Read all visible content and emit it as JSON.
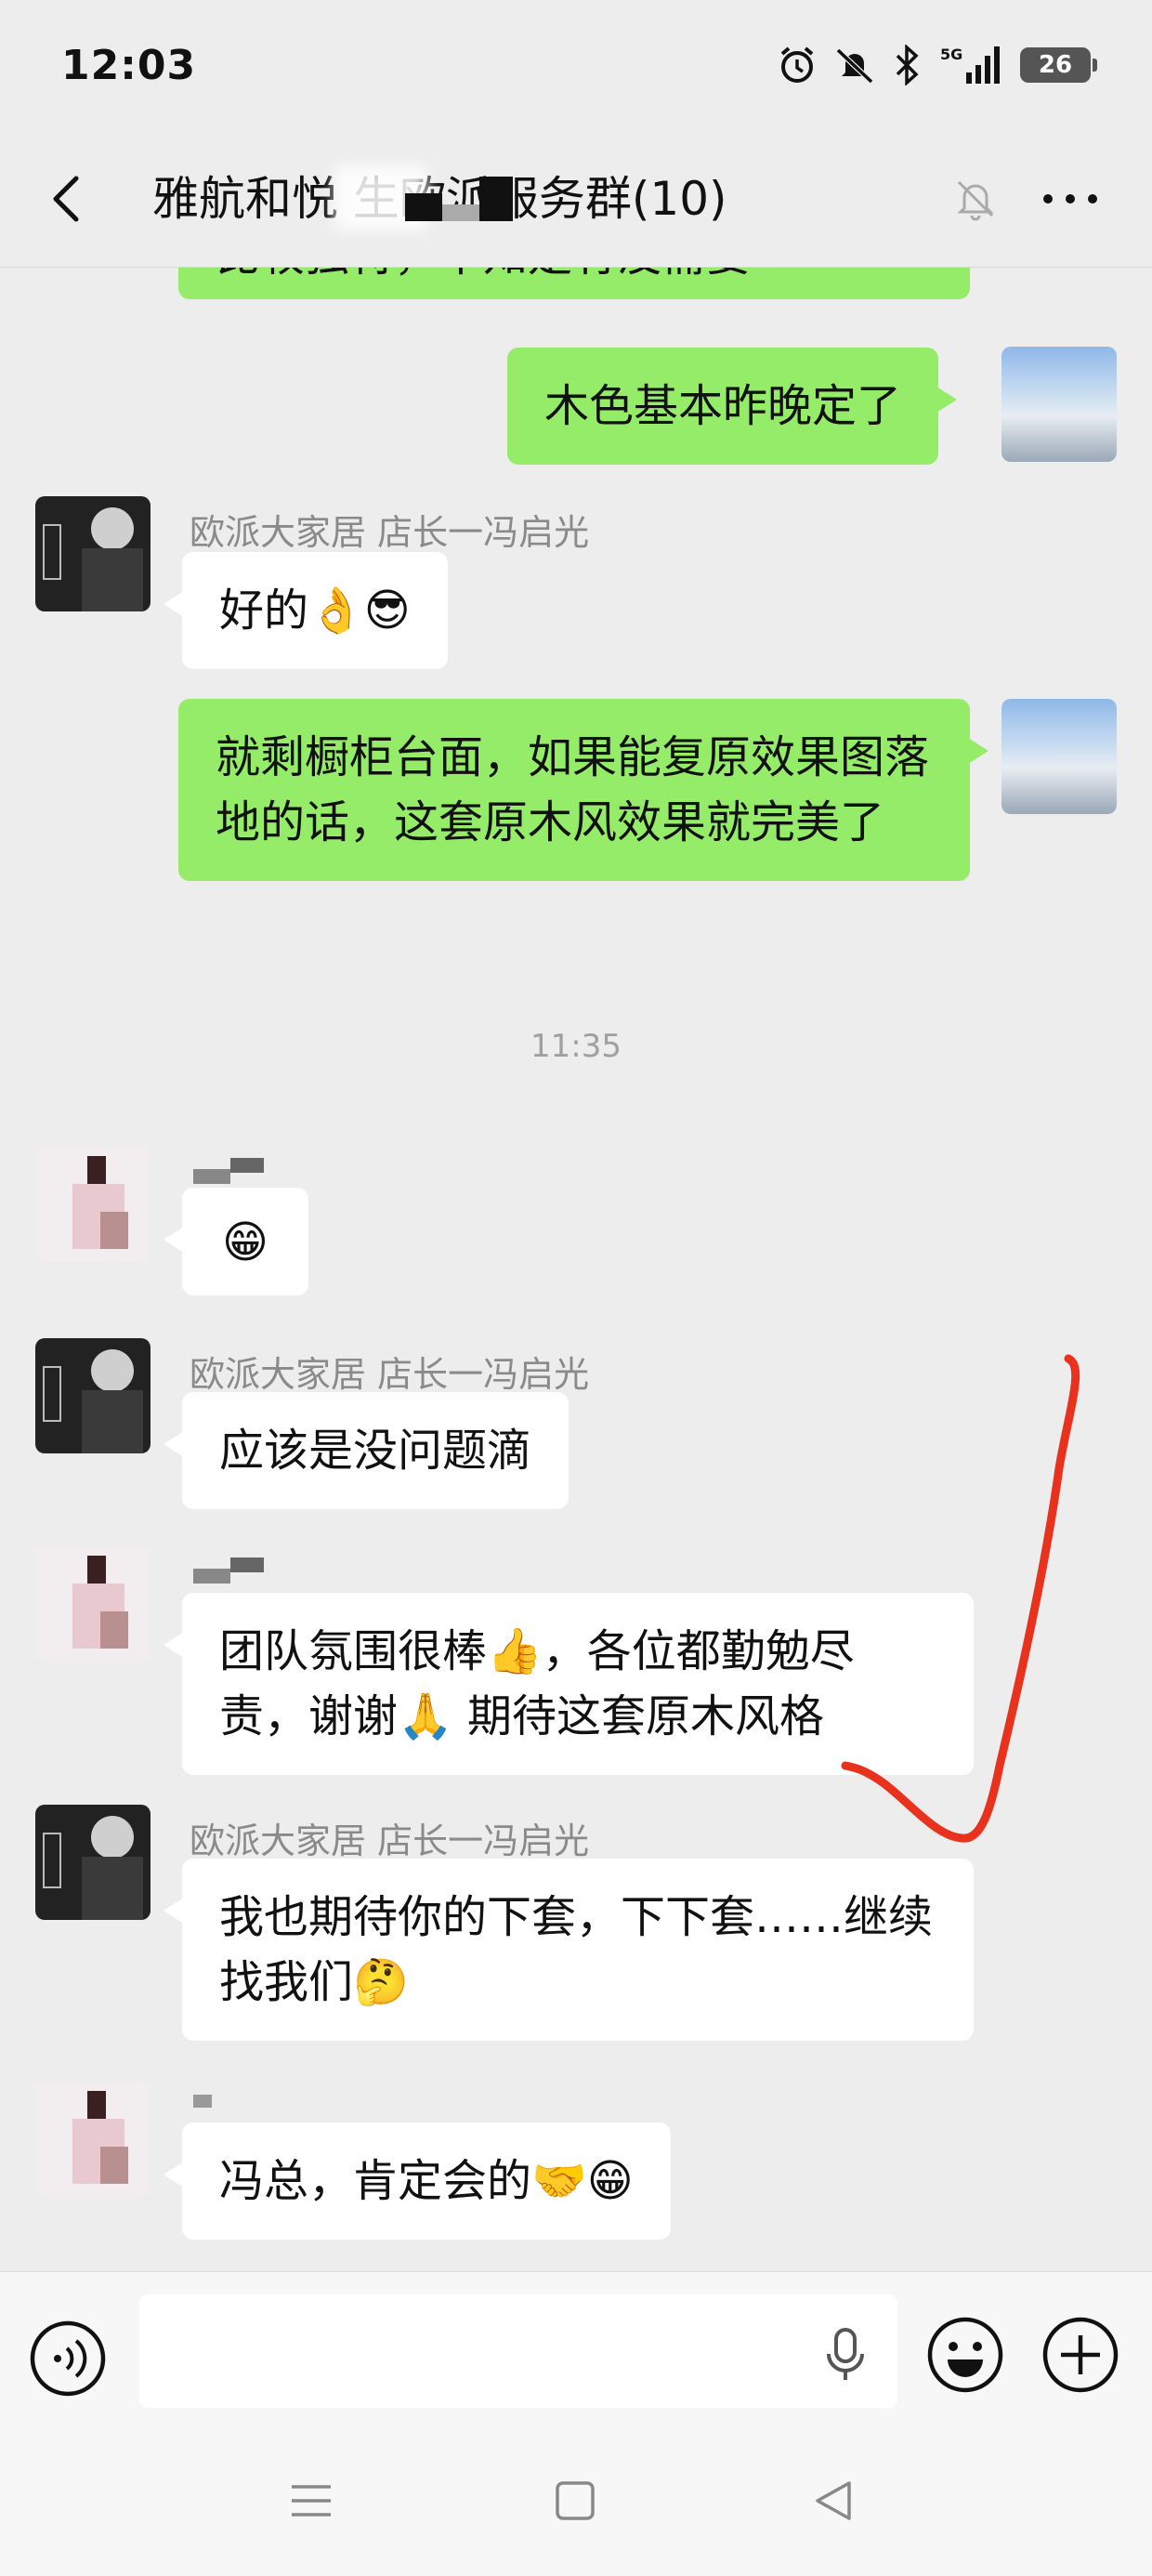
{
  "status_bar": {
    "time": "12:03",
    "network": "5G",
    "battery": "26"
  },
  "header": {
    "title": "雅航和悦 生欧派服务群(10)"
  },
  "messages": {
    "m0_partial": "比较独特，不知是有没需要",
    "m1": "木色基本昨晚定了",
    "store_name": "欧派大家居 店长一冯启光",
    "m2": "好的👌😎",
    "m3": "就剩橱柜台面，如果能复原效果图落地的话，这套原木风效果就完美了",
    "time_divider": "11:35",
    "m4": "😁",
    "m5": "应该是没问题滴",
    "m6": "团队氛围很棒👍，各位都勤勉尽责，谢谢🙏 期待这套原木风格",
    "m7": "我也期待你的下套，下下套……继续找我们🤔",
    "m8": "冯总，肯定会的🤝😁"
  },
  "input": {
    "placeholder": ""
  },
  "icons": {
    "back": "back-arrow-icon",
    "mute": "mute-bell-icon",
    "more": "more-dots-icon",
    "voice": "voice-icon",
    "mic": "microphone-icon",
    "emoji": "emoji-icon",
    "plus": "plus-icon"
  },
  "colors": {
    "outgoing_bubble": "#95ec69",
    "incoming_bubble": "#ffffff",
    "background": "#ededed",
    "annotation": "#e8321e"
  }
}
